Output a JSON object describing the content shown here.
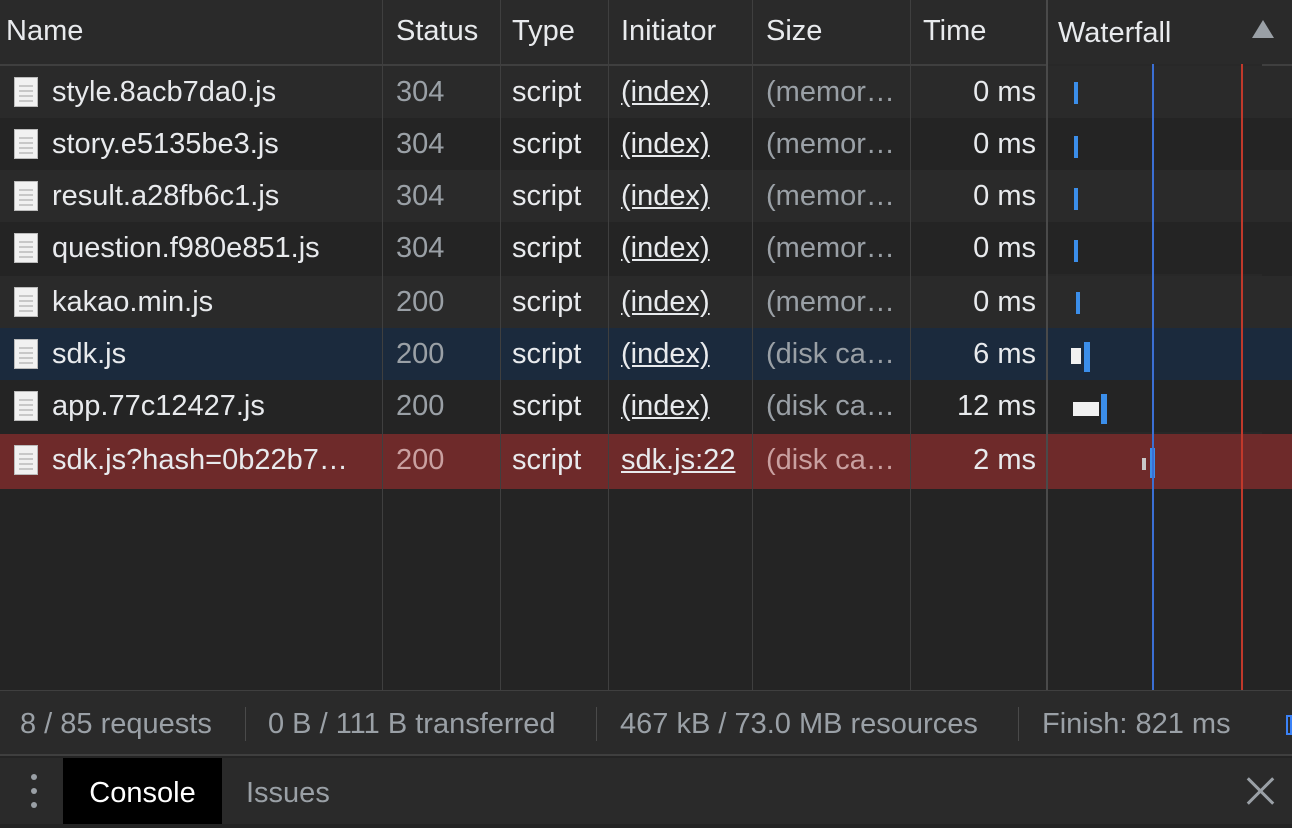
{
  "columns": {
    "name": "Name",
    "status": "Status",
    "type": "Type",
    "initiator": "Initiator",
    "size": "Size",
    "time": "Time",
    "waterfall": "Waterfall"
  },
  "rows": [
    {
      "name": "style.8acb7da0.js",
      "status": "304",
      "type": "script",
      "initiator": "(index)",
      "size": "(memor…",
      "time": "0 ms"
    },
    {
      "name": "story.e5135be3.js",
      "status": "304",
      "type": "script",
      "initiator": "(index)",
      "size": "(memor…",
      "time": "0 ms"
    },
    {
      "name": "result.a28fb6c1.js",
      "status": "304",
      "type": "script",
      "initiator": "(index)",
      "size": "(memor…",
      "time": "0 ms"
    },
    {
      "name": "question.f980e851.js",
      "status": "304",
      "type": "script",
      "initiator": "(index)",
      "size": "(memor…",
      "time": "0 ms"
    },
    {
      "name": "kakao.min.js",
      "status": "200",
      "type": "script",
      "initiator": "(index)",
      "size": "(memor…",
      "time": "0 ms"
    },
    {
      "name": "sdk.js",
      "status": "200",
      "type": "script",
      "initiator": "(index)",
      "size": "(disk ca…",
      "time": "6 ms"
    },
    {
      "name": "app.77c12427.js",
      "status": "200",
      "type": "script",
      "initiator": "(index)",
      "size": "(disk ca…",
      "time": "12 ms"
    },
    {
      "name": "sdk.js?hash=0b22b7…",
      "status": "200",
      "type": "script",
      "initiator": "sdk.js:22",
      "size": "(disk ca…",
      "time": "2 ms"
    }
  ],
  "status_bar": {
    "requests": "8 / 85 requests",
    "transferred": "0 B / 111 B transferred",
    "resources": "467 kB / 73.0 MB resources",
    "finish": "Finish: 821 ms"
  },
  "drawer": {
    "tabs": [
      "Console",
      "Issues"
    ]
  },
  "colors": {
    "selected_row": "#1b2a3d",
    "error_row": "#6e2a2a",
    "dom_content_loaded_line": "#3b6fd4",
    "load_line": "#c0392b",
    "waterfall_bar": "#3b8eea"
  },
  "icons": [
    "script-file-icon",
    "sort-ascending-icon",
    "more-vert-icon",
    "close-icon"
  ]
}
